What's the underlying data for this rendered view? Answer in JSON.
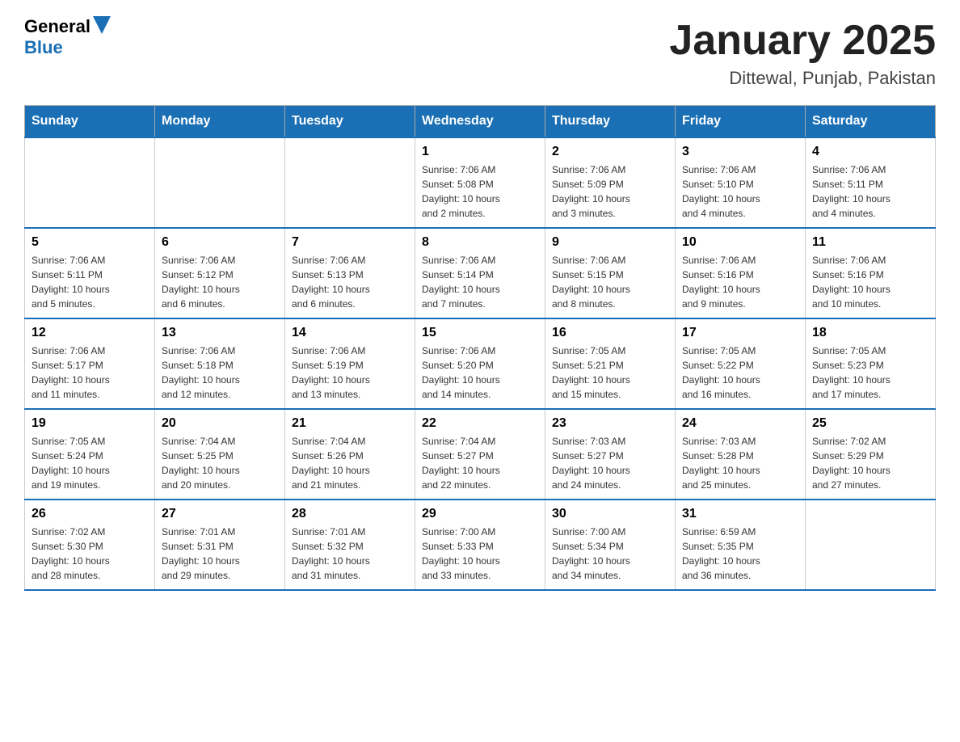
{
  "header": {
    "logo_general": "General",
    "logo_blue": "Blue",
    "month_title": "January 2025",
    "location": "Dittewal, Punjab, Pakistan"
  },
  "days_of_week": [
    "Sunday",
    "Monday",
    "Tuesday",
    "Wednesday",
    "Thursday",
    "Friday",
    "Saturday"
  ],
  "weeks": [
    [
      {
        "day": "",
        "info": ""
      },
      {
        "day": "",
        "info": ""
      },
      {
        "day": "",
        "info": ""
      },
      {
        "day": "1",
        "info": "Sunrise: 7:06 AM\nSunset: 5:08 PM\nDaylight: 10 hours\nand 2 minutes."
      },
      {
        "day": "2",
        "info": "Sunrise: 7:06 AM\nSunset: 5:09 PM\nDaylight: 10 hours\nand 3 minutes."
      },
      {
        "day": "3",
        "info": "Sunrise: 7:06 AM\nSunset: 5:10 PM\nDaylight: 10 hours\nand 4 minutes."
      },
      {
        "day": "4",
        "info": "Sunrise: 7:06 AM\nSunset: 5:11 PM\nDaylight: 10 hours\nand 4 minutes."
      }
    ],
    [
      {
        "day": "5",
        "info": "Sunrise: 7:06 AM\nSunset: 5:11 PM\nDaylight: 10 hours\nand 5 minutes."
      },
      {
        "day": "6",
        "info": "Sunrise: 7:06 AM\nSunset: 5:12 PM\nDaylight: 10 hours\nand 6 minutes."
      },
      {
        "day": "7",
        "info": "Sunrise: 7:06 AM\nSunset: 5:13 PM\nDaylight: 10 hours\nand 6 minutes."
      },
      {
        "day": "8",
        "info": "Sunrise: 7:06 AM\nSunset: 5:14 PM\nDaylight: 10 hours\nand 7 minutes."
      },
      {
        "day": "9",
        "info": "Sunrise: 7:06 AM\nSunset: 5:15 PM\nDaylight: 10 hours\nand 8 minutes."
      },
      {
        "day": "10",
        "info": "Sunrise: 7:06 AM\nSunset: 5:16 PM\nDaylight: 10 hours\nand 9 minutes."
      },
      {
        "day": "11",
        "info": "Sunrise: 7:06 AM\nSunset: 5:16 PM\nDaylight: 10 hours\nand 10 minutes."
      }
    ],
    [
      {
        "day": "12",
        "info": "Sunrise: 7:06 AM\nSunset: 5:17 PM\nDaylight: 10 hours\nand 11 minutes."
      },
      {
        "day": "13",
        "info": "Sunrise: 7:06 AM\nSunset: 5:18 PM\nDaylight: 10 hours\nand 12 minutes."
      },
      {
        "day": "14",
        "info": "Sunrise: 7:06 AM\nSunset: 5:19 PM\nDaylight: 10 hours\nand 13 minutes."
      },
      {
        "day": "15",
        "info": "Sunrise: 7:06 AM\nSunset: 5:20 PM\nDaylight: 10 hours\nand 14 minutes."
      },
      {
        "day": "16",
        "info": "Sunrise: 7:05 AM\nSunset: 5:21 PM\nDaylight: 10 hours\nand 15 minutes."
      },
      {
        "day": "17",
        "info": "Sunrise: 7:05 AM\nSunset: 5:22 PM\nDaylight: 10 hours\nand 16 minutes."
      },
      {
        "day": "18",
        "info": "Sunrise: 7:05 AM\nSunset: 5:23 PM\nDaylight: 10 hours\nand 17 minutes."
      }
    ],
    [
      {
        "day": "19",
        "info": "Sunrise: 7:05 AM\nSunset: 5:24 PM\nDaylight: 10 hours\nand 19 minutes."
      },
      {
        "day": "20",
        "info": "Sunrise: 7:04 AM\nSunset: 5:25 PM\nDaylight: 10 hours\nand 20 minutes."
      },
      {
        "day": "21",
        "info": "Sunrise: 7:04 AM\nSunset: 5:26 PM\nDaylight: 10 hours\nand 21 minutes."
      },
      {
        "day": "22",
        "info": "Sunrise: 7:04 AM\nSunset: 5:27 PM\nDaylight: 10 hours\nand 22 minutes."
      },
      {
        "day": "23",
        "info": "Sunrise: 7:03 AM\nSunset: 5:27 PM\nDaylight: 10 hours\nand 24 minutes."
      },
      {
        "day": "24",
        "info": "Sunrise: 7:03 AM\nSunset: 5:28 PM\nDaylight: 10 hours\nand 25 minutes."
      },
      {
        "day": "25",
        "info": "Sunrise: 7:02 AM\nSunset: 5:29 PM\nDaylight: 10 hours\nand 27 minutes."
      }
    ],
    [
      {
        "day": "26",
        "info": "Sunrise: 7:02 AM\nSunset: 5:30 PM\nDaylight: 10 hours\nand 28 minutes."
      },
      {
        "day": "27",
        "info": "Sunrise: 7:01 AM\nSunset: 5:31 PM\nDaylight: 10 hours\nand 29 minutes."
      },
      {
        "day": "28",
        "info": "Sunrise: 7:01 AM\nSunset: 5:32 PM\nDaylight: 10 hours\nand 31 minutes."
      },
      {
        "day": "29",
        "info": "Sunrise: 7:00 AM\nSunset: 5:33 PM\nDaylight: 10 hours\nand 33 minutes."
      },
      {
        "day": "30",
        "info": "Sunrise: 7:00 AM\nSunset: 5:34 PM\nDaylight: 10 hours\nand 34 minutes."
      },
      {
        "day": "31",
        "info": "Sunrise: 6:59 AM\nSunset: 5:35 PM\nDaylight: 10 hours\nand 36 minutes."
      },
      {
        "day": "",
        "info": ""
      }
    ]
  ]
}
